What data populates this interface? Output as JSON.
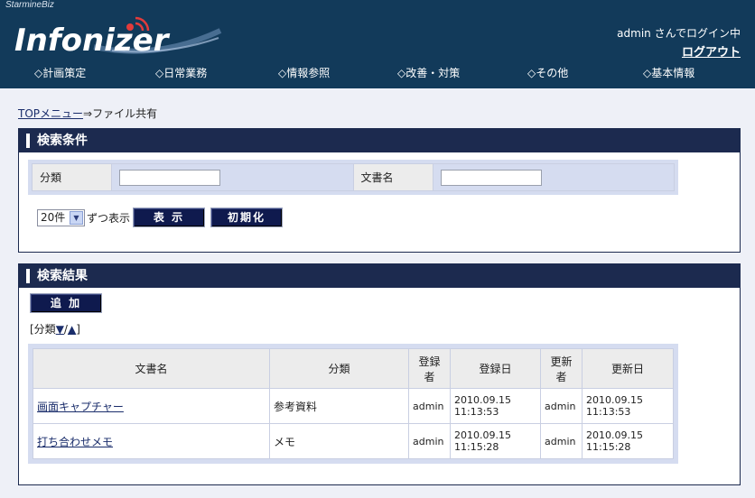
{
  "header": {
    "brand_small": "StarmineBiz",
    "logo_text": "Infonizer",
    "login_info": "admin さんでログイン中",
    "logout_label": "ログアウト",
    "colors": {
      "header_bg": "#123a5a",
      "panel_head": "#1c2a4f",
      "button_bg": "#0f1a4e"
    }
  },
  "nav": [
    {
      "label": "◇計画策定"
    },
    {
      "label": "◇日常業務"
    },
    {
      "label": "◇情報参照"
    },
    {
      "label": "◇改善・対策"
    },
    {
      "label": "◇その他"
    },
    {
      "label": "◇基本情報"
    }
  ],
  "breadcrumb": {
    "top": "TOPメニュー",
    "sep": "⇒",
    "current": "ファイル共有"
  },
  "search": {
    "title": "検索条件",
    "category_label": "分類",
    "category_value": "",
    "docname_label": "文書名",
    "docname_value": "",
    "per_page": "20件",
    "per_page_suffix": "ずつ表示",
    "show_button": "表 示",
    "reset_button": "初期化"
  },
  "results": {
    "title": "検索結果",
    "add_button": "追 加",
    "sort_prefix": "[分類",
    "sort_desc": "▼",
    "sort_sep": "/",
    "sort_asc": "▲",
    "sort_suffix": "]",
    "columns": [
      "文書名",
      "分類",
      "登録者",
      "登録日",
      "更新者",
      "更新日"
    ],
    "rows": [
      {
        "name": "画面キャプチャー",
        "category": "参考資料",
        "registrant": "admin",
        "reg_date": "2010.09.15",
        "reg_time": "11:13:53",
        "updater": "admin",
        "upd_date": "2010.09.15",
        "upd_time": "11:13:53"
      },
      {
        "name": "打ち合わせメモ",
        "category": "メモ",
        "registrant": "admin",
        "reg_date": "2010.09.15",
        "reg_time": "11:15:28",
        "updater": "admin",
        "upd_date": "2010.09.15",
        "upd_time": "11:15:28"
      }
    ]
  }
}
